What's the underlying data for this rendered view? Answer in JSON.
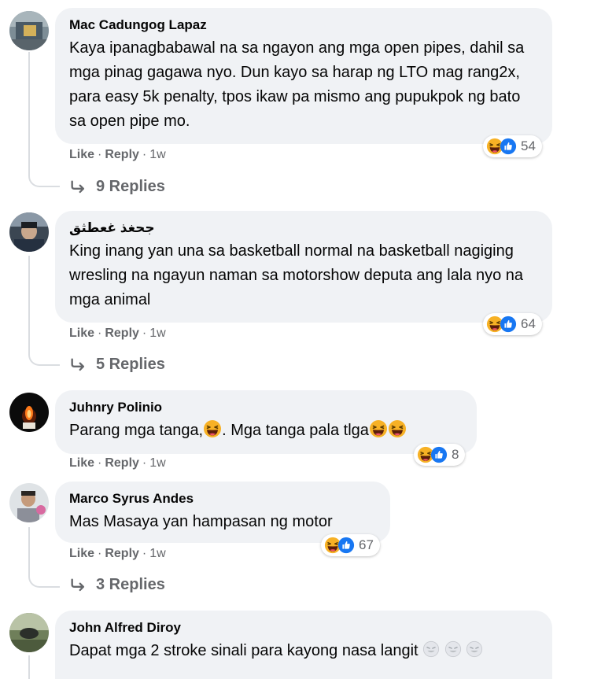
{
  "actions": {
    "like_label": "Like",
    "reply_label": "Reply",
    "separator": "·"
  },
  "comments": [
    {
      "author": "Mac Cadungog Lapaz",
      "text": "Kaya ipanagbabawal na sa ngayon ang mga open pipes, dahil sa mga pinag gagawa nyo. Dun kayo sa harap ng LTO mag rang2x, para easy 5k penalty, tpos ikaw pa mismo ang pupukpok ng bato sa open pipe mo.",
      "reaction_count": "54",
      "time": "1w",
      "replies_label": "9 Replies",
      "reactions": [
        "haha",
        "like"
      ]
    },
    {
      "author": "جحغذ غعطثق",
      "text": "King inang yan una sa basketball normal na basketball nagiging wresling na ngayun naman sa motorshow deputa ang lala nyo na mga animal",
      "reaction_count": "64",
      "time": "1w",
      "replies_label": "5 Replies",
      "reactions": [
        "haha",
        "like"
      ]
    },
    {
      "author": "Juhnry Polinio",
      "text_a": "Parang mga tanga,",
      "text_b": ". Mga tanga pala tlga",
      "reaction_count": "8",
      "time": "1w",
      "reactions": [
        "haha",
        "like"
      ]
    },
    {
      "author": "Marco Syrus Andes",
      "text": "Mas Masaya yan hampasan ng motor",
      "reaction_count": "67",
      "time": "1w",
      "replies_label": "3 Replies",
      "reactions": [
        "haha",
        "like"
      ]
    },
    {
      "author": "John Alfred Diroy",
      "text": "Dapat mga 2 stroke sinali para kayong nasa langit"
    }
  ],
  "colors": {
    "bubble_bg": "#f0f2f5",
    "meta_text": "#65676b",
    "like_blue": "#1877f2",
    "haha_yellow": "#f7b125",
    "thread_line": "#dadde1"
  }
}
